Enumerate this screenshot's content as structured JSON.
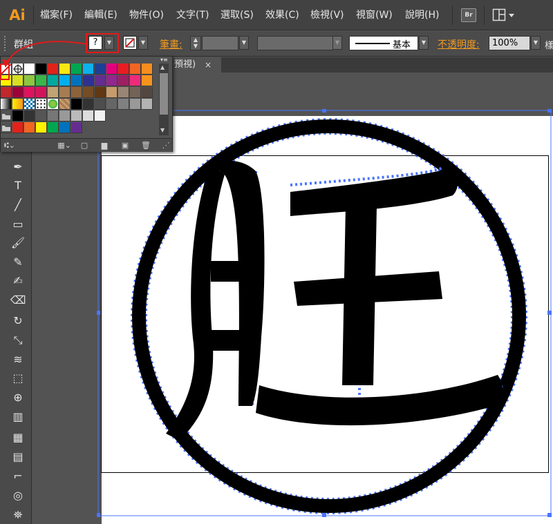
{
  "app": {
    "logo": "Ai",
    "menu": [
      "檔案(F)",
      "編輯(E)",
      "物件(O)",
      "文字(T)",
      "選取(S)",
      "效果(C)",
      "檢視(V)",
      "視窗(W)",
      "說明(H)"
    ],
    "bridge_label": "Br"
  },
  "control_bar": {
    "selection_label": "群組",
    "fill_value": "?",
    "stroke_label": "筆畫:",
    "stroke_style_label": "基本",
    "opacity_label": "不透明度:",
    "opacity_value": "100%",
    "overflow_label": "樣"
  },
  "document": {
    "tab_label": "預視)",
    "tab_close": "×"
  },
  "swatch_panel": {
    "colors": {
      "accent_highlight": "#e01b1b",
      "selection_blue": "#3366ff"
    },
    "rows": [
      [
        "none",
        "register",
        "#ffffff",
        "#000000",
        "#e2231a",
        "#f7e815",
        "#00a650",
        "#0db2ea",
        "#1d3f94",
        "#e3007d",
        "#ec1c24",
        "#f26522",
        "#f68e1f"
      ],
      [
        "#fff100",
        "#d7df23",
        "#8dc63f",
        "#39b54a",
        "#00a99d",
        "#00aeef",
        "#0072bc",
        "#2e3192",
        "#662d91",
        "#92278f",
        "#9e1f63",
        "#ee2a7b",
        "#f7941d"
      ],
      [
        "#c1272d",
        "#9e0039",
        "#e0115f",
        "#d4145a",
        "#bfa573",
        "#a67c52",
        "#8c6239",
        "#754c24",
        "#603813",
        "#c69c6d",
        "#998675",
        "#736357",
        "#534741"
      ],
      [
        "gradient-gray",
        "gradient-yellow",
        "pattern-check",
        "pattern-dots",
        "pattern-leaf",
        "pattern-wood",
        "#000000",
        "#333333",
        "#4d4d4d",
        "#666666",
        "#808080",
        "#999999",
        "#b3b3b3"
      ],
      [
        "folder",
        "#000000",
        "#333333",
        "#555555",
        "#777777",
        "#999999",
        "#bbbbbb",
        "#dddddd",
        "#f2f2f2"
      ],
      [
        "folder",
        "#e2231a",
        "#f26522",
        "#fff100",
        "#00a650",
        "#0072bc",
        "#662d91"
      ]
    ]
  }
}
